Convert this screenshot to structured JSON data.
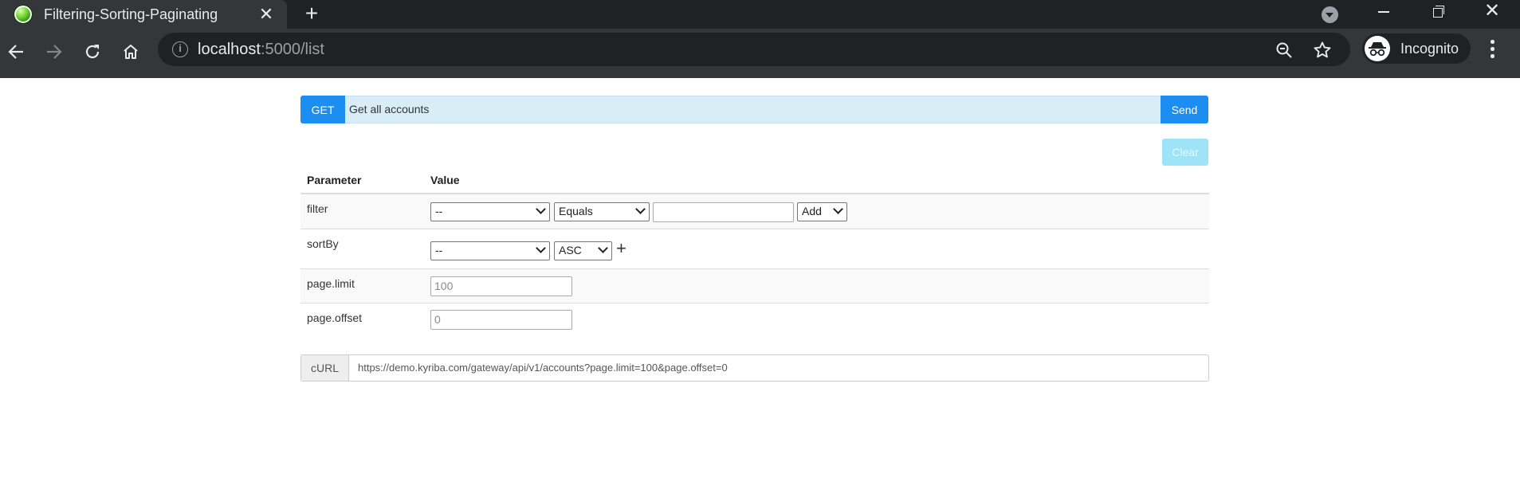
{
  "browser": {
    "tab_title": "Filtering-Sorting-Paginating",
    "tab_close": "✕",
    "new_tab": "+",
    "url_host": "localhost",
    "url_rest": ":5000/list",
    "profile_label": "Incognito",
    "window_close": "✕"
  },
  "request": {
    "method": "GET",
    "description": "Get all accounts",
    "send_label": "Send",
    "clear_label": "Clear"
  },
  "table": {
    "headers": {
      "parameter": "Parameter",
      "value": "Value"
    },
    "rows": {
      "filter": {
        "label": "filter",
        "field_value": "--",
        "operator_value": "Equals",
        "text_value": "",
        "add_value": "Add"
      },
      "sortBy": {
        "label": "sortBy",
        "field_value": "--",
        "direction_value": "ASC",
        "add_symbol": "+"
      },
      "limit": {
        "label": "page.limit",
        "value": "100"
      },
      "offset": {
        "label": "page.offset",
        "value": "0"
      }
    }
  },
  "curl": {
    "label": "cURL",
    "value": "https://demo.kyriba.com/gateway/api/v1/accounts?page.limit=100&page.offset=0"
  },
  "colors": {
    "primary": "#1c8ef2",
    "request_bg": "#d9edf7",
    "clear_disabled": "#9ee3f7",
    "chrome_dark": "#202124",
    "chrome_toolbar": "#35363a"
  }
}
